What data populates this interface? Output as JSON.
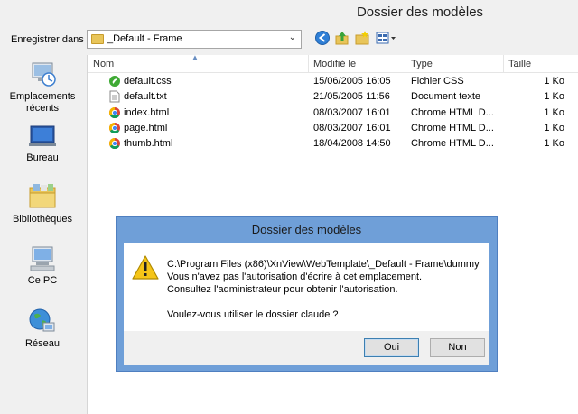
{
  "window": {
    "title": "Dossier des modèles"
  },
  "savein": {
    "label": "Enregistrer dans :",
    "value": "_Default - Frame"
  },
  "places": [
    {
      "label": "Emplacements récents",
      "icon": "recent-places-icon"
    },
    {
      "label": "Bureau",
      "icon": "desktop-icon"
    },
    {
      "label": "Bibliothèques",
      "icon": "libraries-icon"
    },
    {
      "label": "Ce PC",
      "icon": "computer-icon"
    },
    {
      "label": "Réseau",
      "icon": "network-icon"
    }
  ],
  "columns": {
    "name": "Nom",
    "modified": "Modifié le",
    "type": "Type",
    "size": "Taille"
  },
  "files": [
    {
      "name": "default.css",
      "modified": "15/06/2005 16:05",
      "type": "Fichier CSS",
      "size": "1 Ko",
      "icon": "css-file-icon"
    },
    {
      "name": "default.txt",
      "modified": "21/05/2005 11:56",
      "type": "Document texte",
      "size": "1 Ko",
      "icon": "text-file-icon"
    },
    {
      "name": "index.html",
      "modified": "08/03/2007 16:01",
      "type": "Chrome HTML D...",
      "size": "1 Ko",
      "icon": "chrome-html-icon"
    },
    {
      "name": "page.html",
      "modified": "08/03/2007 16:01",
      "type": "Chrome HTML D...",
      "size": "1 Ko",
      "icon": "chrome-html-icon"
    },
    {
      "name": "thumb.html",
      "modified": "18/04/2008 14:50",
      "type": "Chrome HTML D...",
      "size": "1 Ko",
      "icon": "chrome-html-icon"
    }
  ],
  "dialog": {
    "title": "Dossier des modèles",
    "line1": "C:\\Program Files (x86)\\XnView\\WebTemplate\\_Default - Frame\\dummy",
    "line2": "Vous n'avez pas l'autorisation d'écrire à cet emplacement.",
    "line3": "Consultez l'administrateur pour obtenir l'autorisation.",
    "question": "Voulez-vous utiliser le dossier claude ?",
    "ok_label": "Oui",
    "no_label": "Non"
  },
  "colors": {
    "dialog_frame": "#6f9fd8",
    "ok_border": "#3c7fb1",
    "folder": "#e8c55a"
  }
}
